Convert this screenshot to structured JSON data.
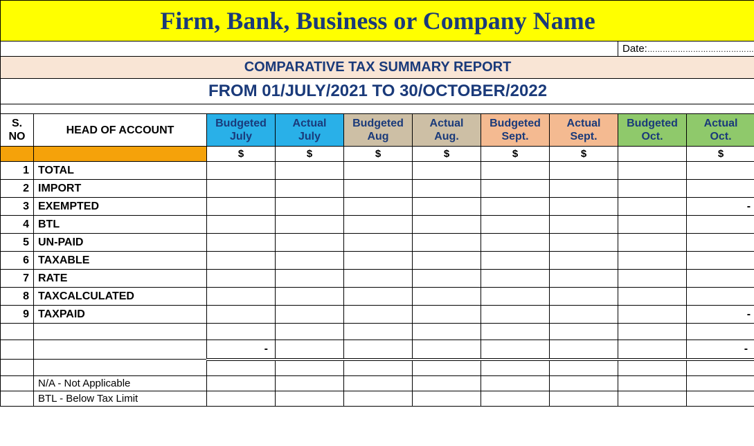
{
  "title": "Firm, Bank, Business or Company  Name",
  "date_label": "Date:",
  "date_value": "…………………………………………………",
  "subtitle": "COMPARATIVE TAX  SUMMARY REPORT",
  "period": "FROM 01/JULY/2021  TO 30/OCTOBER/2022",
  "headers": {
    "sno": "S. NO",
    "head": "HEAD OF ACCOUNT",
    "cols": [
      {
        "line1": "Budgeted",
        "line2": "July"
      },
      {
        "line1": "Actual",
        "line2": "July"
      },
      {
        "line1": "Budgeted",
        "line2": "Aug"
      },
      {
        "line1": "Actual",
        "line2": "Aug."
      },
      {
        "line1": "Budgeted",
        "line2": "Sept."
      },
      {
        "line1": "Actual",
        "line2": "Sept."
      },
      {
        "line1": "Budgeted",
        "line2": "Oct."
      },
      {
        "line1": "Actual",
        "line2": "Oct."
      }
    ]
  },
  "currency_symbols": [
    "$",
    "$",
    "$",
    "$",
    "$",
    "$",
    "",
    "$"
  ],
  "rows": [
    {
      "sno": "1",
      "name": " TOTAL",
      "vals": [
        "",
        "",
        "",
        "",
        "",
        "",
        "",
        ""
      ]
    },
    {
      "sno": "2",
      "name": "IMPORT",
      "vals": [
        "",
        "",
        "",
        "",
        "",
        "",
        "",
        ""
      ]
    },
    {
      "sno": "3",
      "name": "EXEMPTED",
      "vals": [
        "",
        "",
        "",
        "",
        "",
        "",
        "",
        "-"
      ]
    },
    {
      "sno": "4",
      "name": "BTL",
      "vals": [
        "",
        "",
        "",
        "",
        "",
        "",
        "",
        ""
      ]
    },
    {
      "sno": "5",
      "name": "UN-PAID",
      "vals": [
        "",
        "",
        "",
        "",
        "",
        "",
        "",
        ""
      ]
    },
    {
      "sno": "6",
      "name": "TAXABLE",
      "vals": [
        "",
        "",
        "",
        "",
        "",
        "",
        "",
        ""
      ]
    },
    {
      "sno": "7",
      "name": "RATE",
      "vals": [
        "",
        "",
        "",
        "",
        "",
        "",
        "",
        ""
      ]
    },
    {
      "sno": "8",
      "name": "TAXCALCULATED",
      "vals": [
        "",
        "",
        "",
        "",
        "",
        "",
        "",
        ""
      ]
    },
    {
      "sno": "9",
      "name": "TAXPAID",
      "vals": [
        "",
        "",
        "",
        "",
        "",
        "",
        "",
        "-"
      ]
    }
  ],
  "total_row": [
    "-",
    "",
    "",
    "",
    "",
    "",
    "",
    "-"
  ],
  "legend": [
    "N/A - Not Applicable",
    "BTL - Below Tax Limit"
  ]
}
